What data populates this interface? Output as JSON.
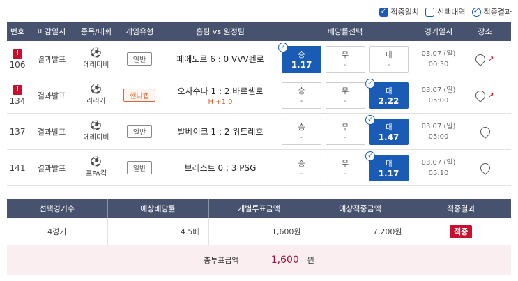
{
  "filters": [
    {
      "label": "적중일치",
      "state": "checked"
    },
    {
      "label": "선택내역",
      "state": "empty"
    },
    {
      "label": "적중결과",
      "state": "round"
    }
  ],
  "headers": {
    "no": "번호",
    "deadline": "마감일시",
    "league": "종목/대회",
    "type": "게임유형",
    "teams": "홈팀 vs 원정팀",
    "odds": "배당률선택",
    "date": "경기일시",
    "place": "장소"
  },
  "games": [
    {
      "alert": "!",
      "no": "106",
      "status": "결과발표",
      "ball": "⚽",
      "league": "에레디비",
      "type": "일반",
      "handicap": false,
      "match": "페에노르 6 : 0 VVV펜로",
      "hline": "",
      "odds": [
        {
          "label": "승",
          "value": "1.17",
          "selected": true
        },
        {
          "label": "무",
          "value": "-",
          "selected": false
        },
        {
          "label": "패",
          "value": "-",
          "selected": false
        }
      ],
      "date": "03.07 (일)",
      "time": "00:30",
      "trend": true
    },
    {
      "alert": "!",
      "no": "134",
      "status": "결과발표",
      "ball": "⚽",
      "league": "라리가",
      "type": "핸디캡",
      "handicap": true,
      "match": "오사수나 1 : 2 바르셀로",
      "hline": "H +1.0",
      "odds": [
        {
          "label": "승",
          "value": "-",
          "selected": false
        },
        {
          "label": "무",
          "value": "-",
          "selected": false
        },
        {
          "label": "패",
          "value": "2.22",
          "selected": true
        }
      ],
      "date": "03.07 (일)",
      "time": "05:00",
      "trend": true
    },
    {
      "alert": "",
      "no": "137",
      "status": "결과발표",
      "ball": "⚽",
      "league": "에레디비",
      "type": "일반",
      "handicap": false,
      "match": "발베이크 1 : 2 위트레흐",
      "hline": "",
      "odds": [
        {
          "label": "승",
          "value": "-",
          "selected": false
        },
        {
          "label": "무",
          "value": "-",
          "selected": false
        },
        {
          "label": "패",
          "value": "1.47",
          "selected": true
        }
      ],
      "date": "03.07 (일)",
      "time": "05:00",
      "trend": false
    },
    {
      "alert": "",
      "no": "141",
      "status": "결과발표",
      "ball": "⚽",
      "league": "프FA컵",
      "type": "일반",
      "handicap": false,
      "match": "브레스트 0 : 3 PSG",
      "hline": "",
      "odds": [
        {
          "label": "승",
          "value": "-",
          "selected": false
        },
        {
          "label": "무",
          "value": "-",
          "selected": false
        },
        {
          "label": "패",
          "value": "1.17",
          "selected": true
        }
      ],
      "date": "03.07 (일)",
      "time": "05:10",
      "trend": false
    }
  ],
  "summary": {
    "headers": [
      "선택경기수",
      "예상배당률",
      "개별투표금액",
      "예상적중금액",
      "적중결과"
    ],
    "count": "4경기",
    "odds": "4.5배",
    "bet": "1,600원",
    "expected": "7,200원",
    "result": "적중"
  },
  "total": {
    "label": "총투표금액",
    "amount": "1,600",
    "unit": "원"
  },
  "colors": {
    "header": "#47526f",
    "selected": "#1a5bb5",
    "alert": "#c8102e",
    "handicap": "#d9663a"
  }
}
